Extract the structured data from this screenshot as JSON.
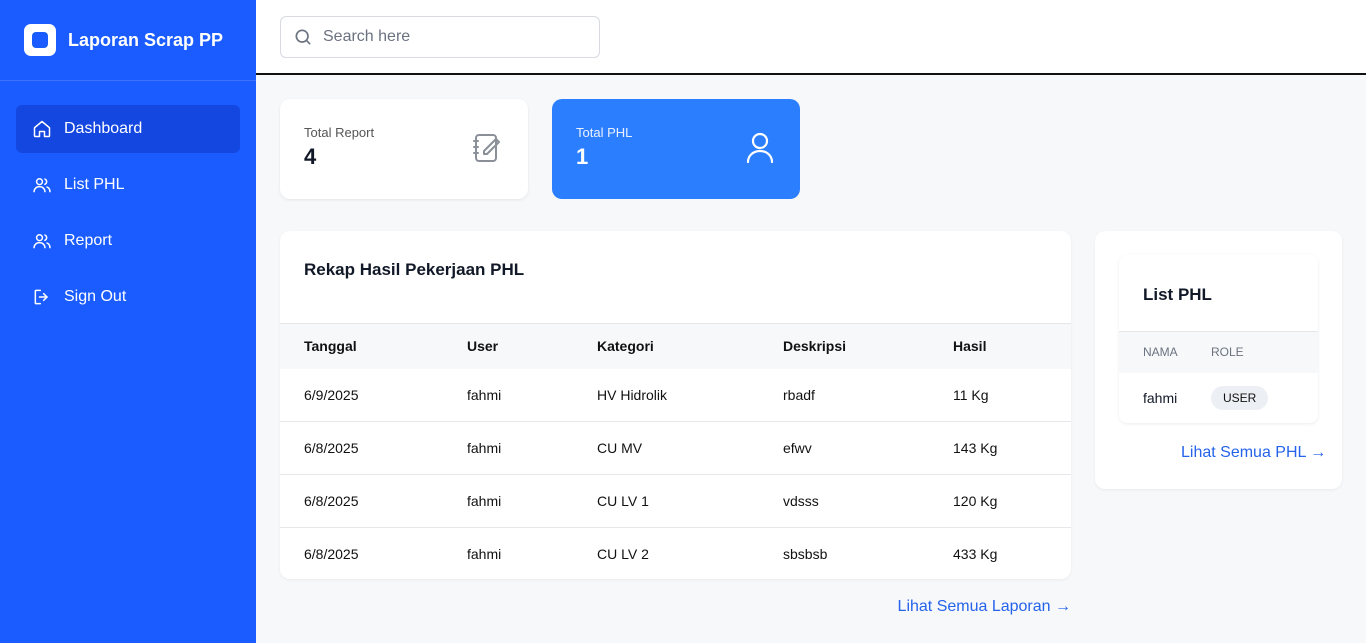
{
  "brand": {
    "title": "Laporan Scrap PP"
  },
  "sidebar": {
    "items": [
      {
        "label": "Dashboard",
        "icon": "home-icon",
        "active": true
      },
      {
        "label": "List PHL",
        "icon": "users-icon",
        "active": false
      },
      {
        "label": "Report",
        "icon": "users-icon",
        "active": false
      },
      {
        "label": "Sign Out",
        "icon": "sign-out-icon",
        "active": false
      }
    ]
  },
  "search": {
    "placeholder": "Search here",
    "value": ""
  },
  "stats": [
    {
      "label": "Total Report",
      "value": "4",
      "icon": "notebook-edit-icon"
    },
    {
      "label": "Total PHL",
      "value": "1",
      "icon": "user-icon"
    }
  ],
  "report": {
    "title": "Rekap Hasil Pekerjaan PHL",
    "columns": [
      "Tanggal",
      "User",
      "Kategori",
      "Deskripsi",
      "Hasil"
    ],
    "rows": [
      [
        "6/9/2025",
        "fahmi",
        "HV Hidrolik",
        "rbadf",
        "11 Kg"
      ],
      [
        "6/8/2025",
        "fahmi",
        "CU MV",
        "efwv",
        "143 Kg"
      ],
      [
        "6/8/2025",
        "fahmi",
        "CU LV 1",
        "vdsss",
        "120 Kg"
      ],
      [
        "6/8/2025",
        "fahmi",
        "CU LV 2",
        "sbsbsb",
        "433 Kg"
      ]
    ],
    "link": "Lihat Semua Laporan →"
  },
  "phl": {
    "title": "List PHL",
    "columns": [
      "NAMA",
      "ROLE"
    ],
    "rows": [
      {
        "nama": "fahmi",
        "role": "USER"
      }
    ],
    "link": "Lihat Semua PHL →"
  },
  "colors": {
    "sidebar": "#1a5cff",
    "sidebar_active": "#1446e0",
    "accent_card": "#2b7fff",
    "link": "#2563eb"
  }
}
